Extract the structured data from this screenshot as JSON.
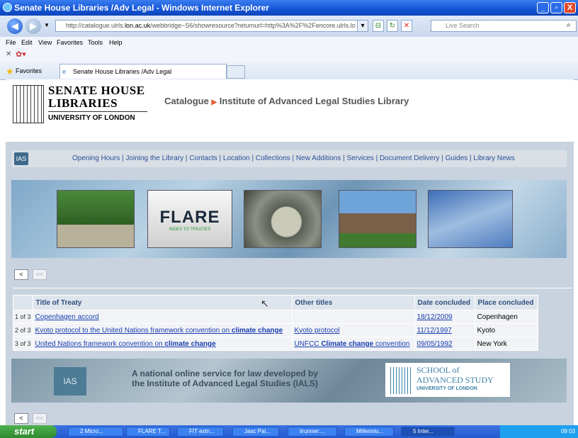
{
  "window": {
    "title": "Senate House Libraries /Adv Legal - Windows Internet Explorer",
    "controls": [
      "_",
      "▫",
      "X"
    ]
  },
  "addressbar": {
    "url_prefix": "http://catalogue.ulrls.",
    "url_domain": "lon.ac.uk",
    "url_rest": "/webbridge~S6/showresource?returnurl=http%3A%2F%2Fencore.ulrls.lo",
    "search_placeholder": "Live Search"
  },
  "menu": [
    "File",
    "Edit",
    "View",
    "Favorites",
    "Tools",
    "Help"
  ],
  "favorites": {
    "label": "Favorites",
    "tab_title": "Senate House Libraries /Adv Legal"
  },
  "header": {
    "logo_line1": "SENATE HOUSE",
    "logo_line2": "LIBRARIES",
    "logo_line3": "UNIVERSITY OF LONDON",
    "breadcrumb_catalogue": "Catalogue",
    "breadcrumb_arrow": "▶",
    "breadcrumb_library": "Institute of Advanced Legal Studies Library"
  },
  "nav": {
    "ias_logo": "IAS",
    "links_text": "Opening Hours | Joining the Library | Contacts | Location | Collections | New Additions | Services | Document Delivery | Guides | Library News"
  },
  "banner": {
    "flare_title": "FLARE",
    "flare_subtitle": "INDEX TO TREATIES"
  },
  "pager": {
    "prev": "<",
    "first": "<<"
  },
  "results": {
    "headers": [
      "Title of Treaty",
      "Other titles",
      "Date concluded",
      "Place concluded"
    ],
    "rows": [
      {
        "num": "1 of 3",
        "title_pre": "Copenhagen accord",
        "title_bold": "",
        "other_pre": "",
        "other_bold": "",
        "other_post": "",
        "date": "18/12/2009",
        "place": "Copenhagen"
      },
      {
        "num": "2 of 3",
        "title_pre": "Kyoto protocol to the United Nations framework convention on ",
        "title_bold": "climate change",
        "other_pre": "Kyoto protocol",
        "other_bold": "",
        "other_post": "",
        "date": "11/12/1997",
        "place": "Kyoto"
      },
      {
        "num": "3 of 3",
        "title_pre": "United Nations framework convention on ",
        "title_bold": "climate change",
        "other_pre": "UNFCC ",
        "other_bold": "Climate change",
        "other_post": " convention",
        "date": "09/05/1992",
        "place": "New York"
      }
    ]
  },
  "footer": {
    "line1": "A national online service for law developed by",
    "line2": "the Institute of Advanced Legal Studies (IALS)",
    "school_line1": "SCHOOL of",
    "school_line2": "ADVANCED STUDY",
    "school_line3": "UNIVERSITY OF LONDON"
  },
  "taskbar": {
    "start": "start",
    "items": [
      "2 Micro...",
      "FLARE T...",
      "FIT extn...",
      "Jasc Pai...",
      "iirunner:...",
      "Millenniu...",
      "5 Inter..."
    ],
    "clock": "09:03"
  }
}
